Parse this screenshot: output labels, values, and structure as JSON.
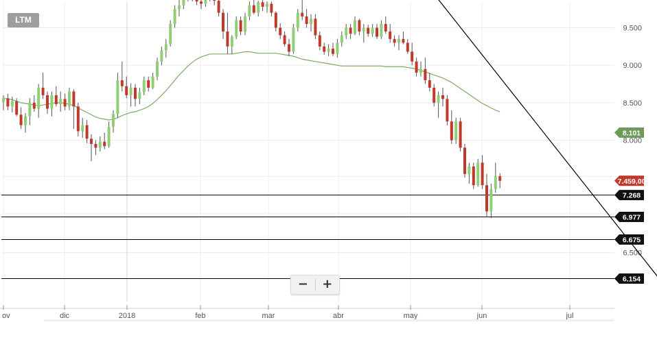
{
  "ticker": "LTM",
  "zoom": {
    "out_label": "−",
    "in_label": "+"
  },
  "colors": {
    "up": "#8fcf75",
    "down": "#c0392b",
    "ma": "#7daa6a",
    "trend": "#000000",
    "ma_badge": "#6f9a5c",
    "price_badge": "#c0392b",
    "level_badge": "#111111",
    "grid": "#ececec"
  },
  "chart_data": {
    "type": "candlestick",
    "x_axis": {
      "labels": [
        "ov",
        "dic",
        "2018",
        "feb",
        "mar",
        "abr",
        "may",
        "jun",
        "jul"
      ]
    },
    "y_axis": {
      "labels": [
        "6.500",
        "8.000",
        "8.500",
        "9.000",
        "9.500"
      ]
    },
    "ylim": [
      5950,
      9900
    ],
    "grid": true,
    "candles": [
      [
        8510,
        8600,
        8400,
        8560
      ],
      [
        8560,
        8620,
        8400,
        8450
      ],
      [
        8450,
        8580,
        8370,
        8520
      ],
      [
        8520,
        8560,
        8320,
        8340
      ],
      [
        8340,
        8440,
        8150,
        8200
      ],
      [
        8200,
        8360,
        8100,
        8320
      ],
      [
        8320,
        8560,
        8200,
        8500
      ],
      [
        8500,
        8600,
        8380,
        8420
      ],
      [
        8420,
        8750,
        8300,
        8700
      ],
      [
        8700,
        8900,
        8550,
        8600
      ],
      [
        8600,
        8650,
        8350,
        8420
      ],
      [
        8420,
        8650,
        8320,
        8600
      ],
      [
        8600,
        8720,
        8450,
        8480
      ],
      [
        8480,
        8650,
        8380,
        8550
      ],
      [
        8550,
        8620,
        8400,
        8450
      ],
      [
        8450,
        8700,
        8400,
        8650
      ],
      [
        8650,
        8680,
        8150,
        8450
      ],
      [
        8450,
        8500,
        8050,
        8120
      ],
      [
        8120,
        8300,
        8030,
        8200
      ],
      [
        8200,
        8270,
        7960,
        8020
      ],
      [
        8020,
        8080,
        7720,
        7950
      ],
      [
        7950,
        8000,
        7800,
        7900
      ],
      [
        7900,
        8050,
        7850,
        7980
      ],
      [
        7980,
        8100,
        7880,
        7920
      ],
      [
        7920,
        8250,
        7900,
        8180
      ],
      [
        8180,
        8400,
        8100,
        8350
      ],
      [
        8350,
        8900,
        8300,
        8800
      ],
      [
        8800,
        9050,
        8650,
        8720
      ],
      [
        8720,
        8850,
        8560,
        8600
      ],
      [
        8600,
        8760,
        8450,
        8700
      ],
      [
        8700,
        8750,
        8450,
        8550
      ],
      [
        8550,
        8700,
        8480,
        8640
      ],
      [
        8640,
        8850,
        8600,
        8800
      ],
      [
        8800,
        8850,
        8650,
        8700
      ],
      [
        8700,
        8900,
        8680,
        8850
      ],
      [
        8850,
        9100,
        8800,
        9050
      ],
      [
        9050,
        9250,
        9000,
        9200
      ],
      [
        9200,
        9350,
        9100,
        9280
      ],
      [
        9280,
        9600,
        9250,
        9550
      ],
      [
        9550,
        9800,
        9500,
        9750
      ],
      [
        9750,
        9900,
        9650,
        9800
      ],
      [
        9800,
        9950,
        9750,
        9900
      ],
      [
        9900,
        10000,
        9850,
        9950
      ],
      [
        9950,
        10050,
        9850,
        9900
      ],
      [
        9900,
        10000,
        9800,
        9850
      ],
      [
        9850,
        9900,
        9750,
        9820
      ],
      [
        9820,
        9950,
        9780,
        9900
      ],
      [
        9900,
        10050,
        9850,
        9950
      ],
      [
        9950,
        10050,
        9800,
        9860
      ],
      [
        9860,
        9920,
        9650,
        9700
      ],
      [
        9700,
        9750,
        9350,
        9450
      ],
      [
        9450,
        9700,
        9150,
        9250
      ],
      [
        9250,
        9400,
        9150,
        9380
      ],
      [
        9380,
        9650,
        9350,
        9600
      ],
      [
        9600,
        9650,
        9400,
        9450
      ],
      [
        9450,
        9700,
        9400,
        9650
      ],
      [
        9650,
        9850,
        9600,
        9800
      ],
      [
        9800,
        9900,
        9680,
        9700
      ],
      [
        9700,
        9860,
        9650,
        9840
      ],
      [
        9840,
        9870,
        9720,
        9780
      ],
      [
        9780,
        9850,
        9700,
        9820
      ],
      [
        9820,
        9850,
        9650,
        9700
      ],
      [
        9700,
        9720,
        9450,
        9500
      ],
      [
        9500,
        9560,
        9350,
        9400
      ],
      [
        9400,
        9450,
        9250,
        9280
      ],
      [
        9280,
        9350,
        9120,
        9180
      ],
      [
        9180,
        9550,
        9150,
        9500
      ],
      [
        9500,
        9750,
        9450,
        9700
      ],
      [
        9700,
        9880,
        9600,
        9650
      ],
      [
        9650,
        9750,
        9500,
        9550
      ],
      [
        9550,
        9680,
        9450,
        9620
      ],
      [
        9620,
        9680,
        9350,
        9400
      ],
      [
        9400,
        9450,
        9200,
        9250
      ],
      [
        9250,
        9300,
        9140,
        9180
      ],
      [
        9180,
        9280,
        9120,
        9220
      ],
      [
        9220,
        9300,
        9120,
        9150
      ],
      [
        9150,
        9350,
        9100,
        9300
      ],
      [
        9300,
        9450,
        9250,
        9400
      ],
      [
        9400,
        9550,
        9350,
        9500
      ],
      [
        9500,
        9550,
        9350,
        9420
      ],
      [
        9420,
        9650,
        9400,
        9600
      ],
      [
        9600,
        9620,
        9400,
        9450
      ],
      [
        9450,
        9550,
        9300,
        9500
      ],
      [
        9500,
        9540,
        9380,
        9420
      ],
      [
        9420,
        9550,
        9380,
        9500
      ],
      [
        9500,
        9550,
        9350,
        9380
      ],
      [
        9380,
        9600,
        9350,
        9550
      ],
      [
        9550,
        9650,
        9420,
        9450
      ],
      [
        9450,
        9550,
        9300,
        9350
      ],
      [
        9350,
        9400,
        9250,
        9300
      ],
      [
        9300,
        9400,
        9200,
        9350
      ],
      [
        9350,
        9450,
        9280,
        9300
      ],
      [
        9300,
        9350,
        9150,
        9180
      ],
      [
        9180,
        9300,
        9000,
        9050
      ],
      [
        9050,
        9100,
        8850,
        8900
      ],
      [
        8900,
        9050,
        8850,
        8950
      ],
      [
        8950,
        9100,
        8750,
        8800
      ],
      [
        8800,
        8900,
        8650,
        8700
      ],
      [
        8700,
        8750,
        8450,
        8500
      ],
      [
        8500,
        8650,
        8300,
        8600
      ],
      [
        8600,
        8700,
        8450,
        8550
      ],
      [
        8550,
        8600,
        8200,
        8250
      ],
      [
        8250,
        8400,
        7950,
        8000
      ],
      [
        8000,
        8300,
        7950,
        8250
      ],
      [
        8250,
        8300,
        7850,
        7900
      ],
      [
        7900,
        7950,
        7500,
        7550
      ],
      [
        7550,
        7700,
        7420,
        7650
      ],
      [
        7650,
        7700,
        7350,
        7400
      ],
      [
        7400,
        7750,
        7380,
        7700
      ],
      [
        7700,
        7800,
        7350,
        7400
      ],
      [
        7400,
        7550,
        6970,
        7050
      ],
      [
        7050,
        7420,
        6960,
        7350
      ],
      [
        7350,
        7700,
        7300,
        7520
      ],
      [
        7520,
        7560,
        7360,
        7459
      ]
    ],
    "moving_average": {
      "start_index": 0,
      "values": [
        8560,
        8550,
        8540,
        8520,
        8500,
        8490,
        8480,
        8470,
        8460,
        8470,
        8480,
        8490,
        8500,
        8500,
        8490,
        8480,
        8460,
        8430,
        8400,
        8370,
        8340,
        8310,
        8290,
        8280,
        8270,
        8280,
        8300,
        8330,
        8350,
        8370,
        8380,
        8400,
        8420,
        8450,
        8490,
        8540,
        8600,
        8660,
        8730,
        8800,
        8870,
        8930,
        8990,
        9040,
        9080,
        9110,
        9130,
        9150,
        9150,
        9150,
        9150,
        9150,
        9150,
        9160,
        9170,
        9180,
        9180,
        9170,
        9160,
        9160,
        9160,
        9160,
        9160,
        9150,
        9140,
        9130,
        9120,
        9100,
        9080,
        9070,
        9060,
        9050,
        9040,
        9030,
        9020,
        9010,
        9000,
        8990,
        8990,
        8990,
        8990,
        8990,
        8990,
        8990,
        8990,
        8990,
        8990,
        8980,
        8980,
        8980,
        8980,
        8980,
        8970,
        8960,
        8950,
        8930,
        8910,
        8890,
        8870,
        8850,
        8830,
        8800,
        8770,
        8730,
        8690,
        8650,
        8610,
        8570,
        8530,
        8490,
        8460,
        8430,
        8400,
        8380
      ]
    },
    "trendline": {
      "from": {
        "index": 98,
        "value": 9950
      },
      "to": {
        "index": 152,
        "value": 5950
      }
    },
    "horizontal_levels": [
      7268,
      6977,
      6675,
      6154
    ],
    "badges": {
      "ma_value": "8.101",
      "last_price": "7.459,00",
      "levels": [
        "7.268",
        "6.977",
        "6.675",
        "6.154"
      ]
    }
  }
}
